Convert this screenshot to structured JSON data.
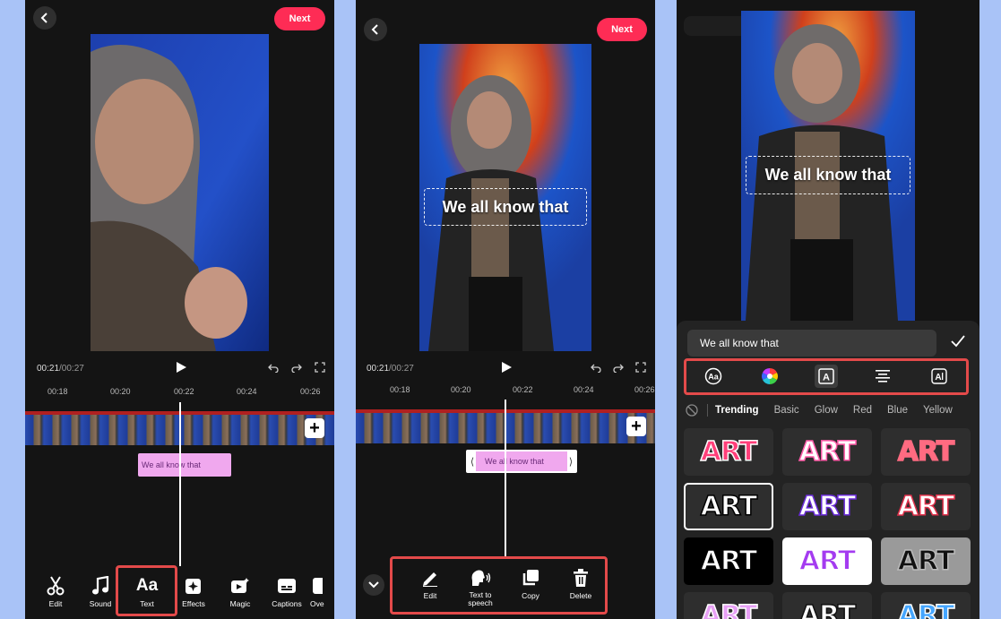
{
  "panel1": {
    "next_label": "Next",
    "time_current": "00:21",
    "time_total": "/00:27",
    "ruler": [
      "00:18",
      "00:20",
      "00:22",
      "00:24",
      "00:26"
    ],
    "clip_text": "We all know that",
    "toolbar": [
      {
        "label": "Edit",
        "icon": "scissors-icon"
      },
      {
        "label": "Sound",
        "icon": "music-note-icon"
      },
      {
        "label": "Text",
        "icon": "text-aa-icon"
      },
      {
        "label": "Effects",
        "icon": "effects-icon"
      },
      {
        "label": "Magic",
        "icon": "magic-icon"
      },
      {
        "label": "Captions",
        "icon": "captions-icon"
      },
      {
        "label": "Ove",
        "icon": "overlay-icon"
      }
    ],
    "highlight_color": "#e34a4a"
  },
  "panel2": {
    "next_label": "Next",
    "overlay_text": "We all know that",
    "time_current": "00:21",
    "time_total": "/00:27",
    "ruler": [
      "00:18",
      "00:20",
      "00:22",
      "00:24",
      "00:26"
    ],
    "clip_text": "We all know that",
    "toolbar": [
      {
        "label": "Edit",
        "icon": "pencil-icon"
      },
      {
        "label": "Text to speech",
        "icon": "text-to-speech-icon"
      },
      {
        "label": "Copy",
        "icon": "copy-icon"
      },
      {
        "label": "Delete",
        "icon": "trash-icon"
      }
    ]
  },
  "panel3": {
    "overlay_text": "We all know that",
    "input_value": "We all know that",
    "options": [
      "font-icon",
      "color-wheel-icon",
      "text-background-icon",
      "align-center-icon",
      "text-style-icon"
    ],
    "categories": [
      "Trending",
      "Basic",
      "Glow",
      "Red",
      "Blue",
      "Yellow"
    ],
    "active_category": "Trending",
    "style_tile_label": "ART",
    "tiles": [
      {
        "label": "ART",
        "fill": "#ff3f7a",
        "stroke": "#ffffff"
      },
      {
        "label": "ART",
        "fill": "#ffffff",
        "stroke": "#ff5aa8"
      },
      {
        "label": "ART",
        "fill": "#ff6b81",
        "stroke": "#ff6b81"
      },
      {
        "label": "ART",
        "fill": "#ffffff",
        "stroke": "#000000"
      },
      {
        "label": "ART",
        "fill": "#ffffff",
        "stroke": "#6a2bd8"
      },
      {
        "label": "ART",
        "fill": "#ffffff",
        "stroke": "#e0304a"
      },
      {
        "label": "ART",
        "fill": "#ffffff",
        "stroke": "#000000"
      },
      {
        "label": "ART",
        "fill": "#a43bf0",
        "stroke": "#ffffff"
      },
      {
        "label": "ART",
        "fill": "#111111",
        "stroke": "#bbbbbb"
      },
      {
        "label": "ART",
        "fill": "#e7a0f5",
        "stroke": "#ffffff"
      },
      {
        "label": "ART",
        "fill": "#ffffff",
        "stroke": "#111111"
      },
      {
        "label": "ART",
        "fill": "#45a6ff",
        "stroke": "#ffffff"
      }
    ]
  }
}
